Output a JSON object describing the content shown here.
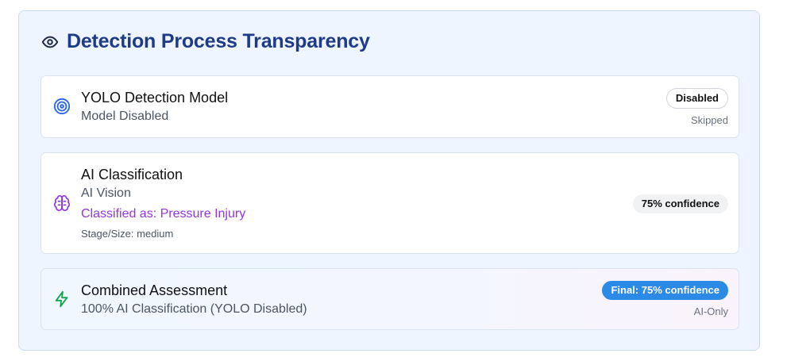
{
  "panel": {
    "title": "Detection Process Transparency",
    "icon": "eye-icon"
  },
  "cards": {
    "yolo": {
      "icon": "target-icon",
      "title": "YOLO Detection Model",
      "subtitle": "Model Disabled",
      "badge": "Disabled",
      "note": "Skipped"
    },
    "ai": {
      "icon": "brain-icon",
      "title": "AI Classification",
      "subtitle": "AI Vision",
      "classified": "Classified as: Pressure Injury",
      "stage": "Stage/Size: medium",
      "badge": "75% confidence"
    },
    "combined": {
      "icon": "lightning-icon",
      "title": "Combined Assessment",
      "subtitle": "100% AI Classification (YOLO Disabled)",
      "badge": "Final: 75% confidence",
      "note": "AI-Only"
    }
  },
  "colors": {
    "title": "#1e3a8a",
    "target_icon": "#2563eb",
    "brain_icon": "#9333ea",
    "lightning_icon": "#16a34a",
    "final_badge": "#2b8ae6",
    "classified_text": "#9333ea"
  }
}
